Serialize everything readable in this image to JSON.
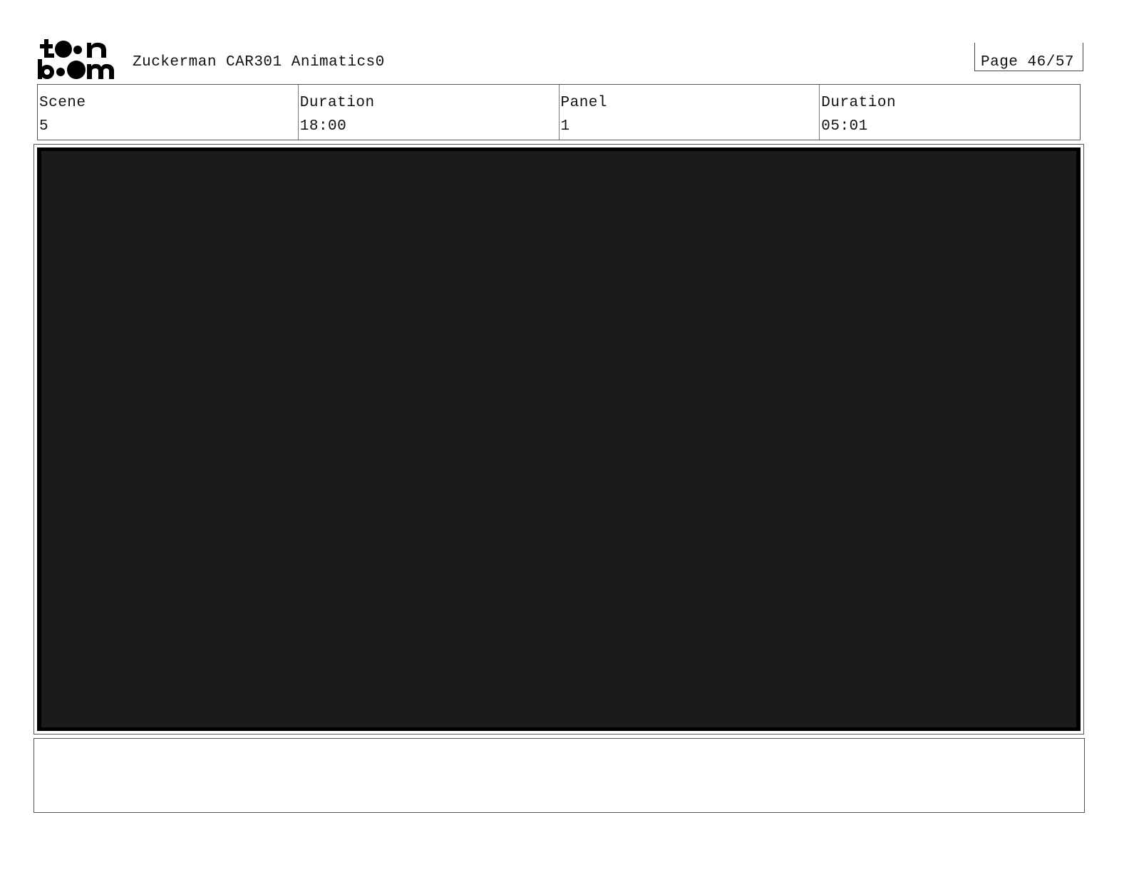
{
  "header": {
    "logo": {
      "name": "toon boom",
      "icon": "toonboom-logo"
    },
    "title": "Zuckerman CAR301 Animatics0",
    "page": "Page 46/57"
  },
  "info": {
    "cells": [
      {
        "label": "Scene",
        "value": "5"
      },
      {
        "label": "Duration",
        "value": "18:00"
      },
      {
        "label": "Panel",
        "value": "1"
      },
      {
        "label": "Duration",
        "value": "05:01"
      }
    ]
  },
  "panel": {
    "background": "#1b1b1b",
    "border": "#000000"
  },
  "notes": {}
}
